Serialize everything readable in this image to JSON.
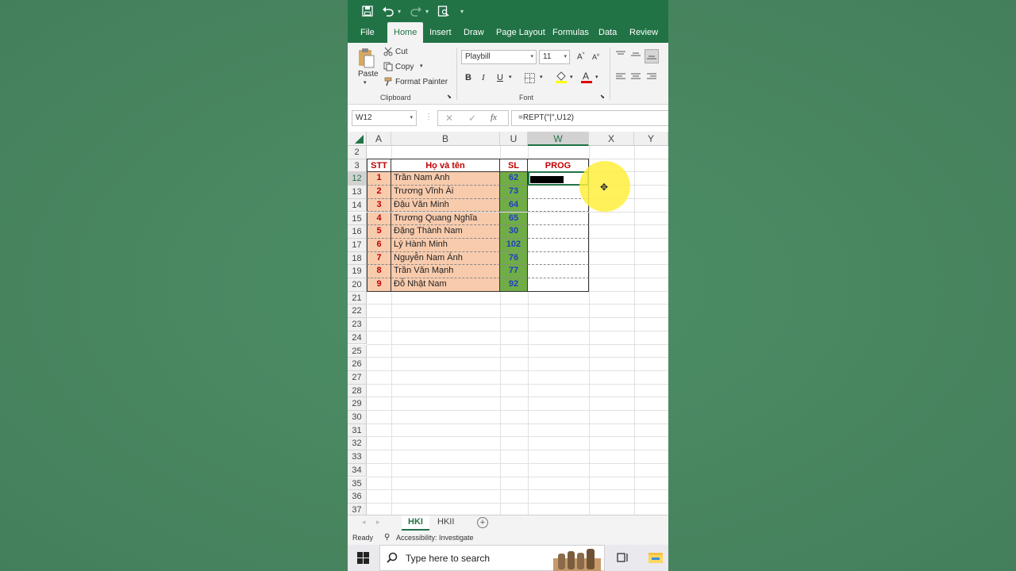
{
  "ribbon": {
    "tabs": [
      "File",
      "Home",
      "Insert",
      "Draw",
      "Page Layout",
      "Formulas",
      "Data",
      "Review"
    ],
    "clipboard": {
      "paste": "Paste",
      "cut": "Cut",
      "copy": "Copy",
      "format_painter": "Format Painter",
      "group_label": "Clipboard"
    },
    "font": {
      "family": "Playbill",
      "size": "11",
      "bold": "B",
      "italic": "I",
      "underline": "U",
      "group_label": "Font"
    }
  },
  "formula_bar": {
    "name_box": "W12",
    "fx": "fx",
    "formula": "=REPT(\"|\",U12)"
  },
  "columns": [
    "A",
    "B",
    "U",
    "W",
    "X",
    "Y"
  ],
  "row_numbers": [
    "2",
    "3",
    "12",
    "13",
    "14",
    "15",
    "16",
    "17",
    "18",
    "19",
    "20",
    "21",
    "22",
    "23",
    "24",
    "25",
    "26",
    "27",
    "28",
    "29",
    "30",
    "31",
    "32",
    "33",
    "34",
    "35",
    "36",
    "37"
  ],
  "table": {
    "headers": {
      "stt": "STT",
      "name": "Họ và tên",
      "sl": "SL",
      "prog": "PROG"
    },
    "rows": [
      {
        "stt": "1",
        "name": "Trần Nam Anh",
        "sl": "62"
      },
      {
        "stt": "2",
        "name": "Trương Vĩnh Ái",
        "sl": "73"
      },
      {
        "stt": "3",
        "name": "Đậu Văn Minh",
        "sl": "64"
      },
      {
        "stt": "4",
        "name": "Trương Quang Nghĩa",
        "sl": "65"
      },
      {
        "stt": "5",
        "name": "Đặng Thành Nam",
        "sl": "30"
      },
      {
        "stt": "6",
        "name": "Lý Hành Minh",
        "sl": "102"
      },
      {
        "stt": "7",
        "name": "Nguyễn Nam Ánh",
        "sl": "76"
      },
      {
        "stt": "8",
        "name": "Trần Văn Mạnh",
        "sl": "77"
      },
      {
        "stt": "9",
        "name": "Đỗ Nhật Nam",
        "sl": "92"
      }
    ]
  },
  "sheets": [
    "HKI",
    "HKII"
  ],
  "status": {
    "ready": "Ready",
    "accessibility": "Accessibility: Investigate"
  },
  "taskbar": {
    "search_placeholder": "Type here to search"
  },
  "colors": {
    "excel_green": "#217346",
    "name_fill": "#f8cbad",
    "sl_fill": "#70ad47",
    "header_red": "#c00000",
    "sl_text": "#1f3fbf"
  }
}
